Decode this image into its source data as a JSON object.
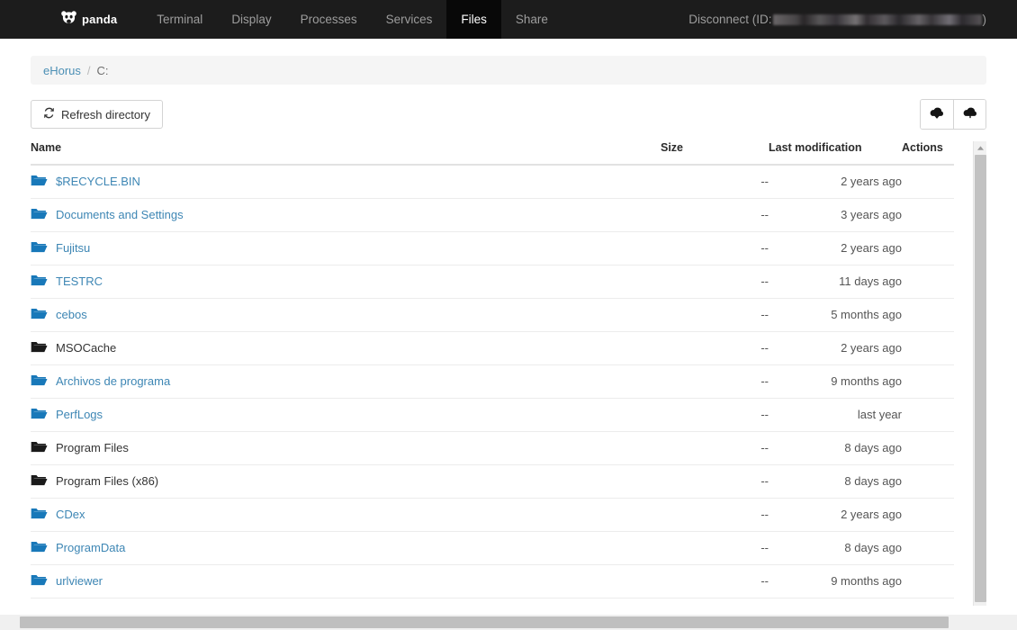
{
  "header": {
    "brand": "panda",
    "brand_icon": "panda-face-icon",
    "nav": [
      {
        "label": "Terminal",
        "active": false
      },
      {
        "label": "Display",
        "active": false
      },
      {
        "label": "Processes",
        "active": false
      },
      {
        "label": "Services",
        "active": false
      },
      {
        "label": "Files",
        "active": true
      },
      {
        "label": "Share",
        "active": false
      }
    ],
    "disconnect_prefix": "Disconnect (ID:",
    "disconnect_suffix": ")",
    "id_value_redacted": true,
    "bg_color": "#1c1c1c",
    "active_tab_bg": "#080808"
  },
  "breadcrumb": {
    "root": "eHorus",
    "separator": "/",
    "current": "C:"
  },
  "toolbar": {
    "refresh_label": "Refresh directory",
    "refresh_icon": "refresh-icon",
    "download_icon": "cloud-download-icon",
    "upload_icon": "cloud-upload-icon"
  },
  "table": {
    "columns": [
      "Name",
      "Size",
      "Last modification",
      "Actions"
    ],
    "rows": [
      {
        "name": "$RECYCLE.BIN",
        "size": "--",
        "modified": "2 years ago",
        "link": true,
        "icon": "folder-icon"
      },
      {
        "name": "Documents and Settings",
        "size": "--",
        "modified": "3 years ago",
        "link": true,
        "icon": "folder-icon"
      },
      {
        "name": "Fujitsu",
        "size": "--",
        "modified": "2 years ago",
        "link": true,
        "icon": "folder-icon"
      },
      {
        "name": "TESTRC",
        "size": "--",
        "modified": "11 days ago",
        "link": true,
        "icon": "folder-icon"
      },
      {
        "name": "cebos",
        "size": "--",
        "modified": "5 months ago",
        "link": true,
        "icon": "folder-icon"
      },
      {
        "name": "MSOCache",
        "size": "--",
        "modified": "2 years ago",
        "link": false,
        "icon": "folder-icon"
      },
      {
        "name": "Archivos de programa",
        "size": "--",
        "modified": "9 months ago",
        "link": true,
        "icon": "folder-icon"
      },
      {
        "name": "PerfLogs",
        "size": "--",
        "modified": "last year",
        "link": true,
        "icon": "folder-icon"
      },
      {
        "name": "Program Files",
        "size": "--",
        "modified": "8 days ago",
        "link": false,
        "icon": "folder-icon"
      },
      {
        "name": "Program Files (x86)",
        "size": "--",
        "modified": "8 days ago",
        "link": false,
        "icon": "folder-icon"
      },
      {
        "name": "CDex",
        "size": "--",
        "modified": "2 years ago",
        "link": true,
        "icon": "folder-icon"
      },
      {
        "name": "ProgramData",
        "size": "--",
        "modified": "8 days ago",
        "link": true,
        "icon": "folder-icon"
      },
      {
        "name": "urlviewer",
        "size": "--",
        "modified": "9 months ago",
        "link": true,
        "icon": "folder-icon"
      }
    ]
  },
  "colors": {
    "link_blue": "#3d86b4",
    "folder_blue": "#1878b9",
    "folder_dark": "#1a1a1a",
    "crumb_blue": "#4b8fb5"
  }
}
